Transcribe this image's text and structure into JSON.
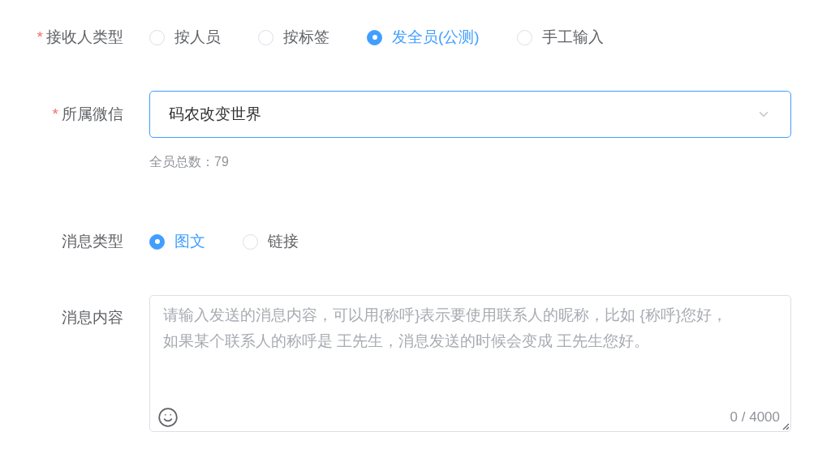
{
  "recipient_type": {
    "label": "接收人类型",
    "required_mark": "*",
    "options": [
      {
        "label": "按人员",
        "selected": false
      },
      {
        "label": "按标签",
        "selected": false
      },
      {
        "label": "发全员(公测)",
        "selected": true
      },
      {
        "label": "手工输入",
        "selected": false
      }
    ]
  },
  "wechat": {
    "label": "所属微信",
    "required_mark": "*",
    "value": "码农改变世界",
    "hint": "全员总数：79"
  },
  "message_type": {
    "label": "消息类型",
    "options": [
      {
        "label": "图文",
        "selected": true
      },
      {
        "label": "链接",
        "selected": false
      }
    ]
  },
  "message_content": {
    "label": "消息内容",
    "placeholder": "请输入发送的消息内容，可以用{称呼}表示要使用联系人的昵称，比如 {称呼}您好，如果某个联系人的称呼是 王先生，消息发送的时候会变成 王先生您好。",
    "counter": "0 / 4000"
  }
}
